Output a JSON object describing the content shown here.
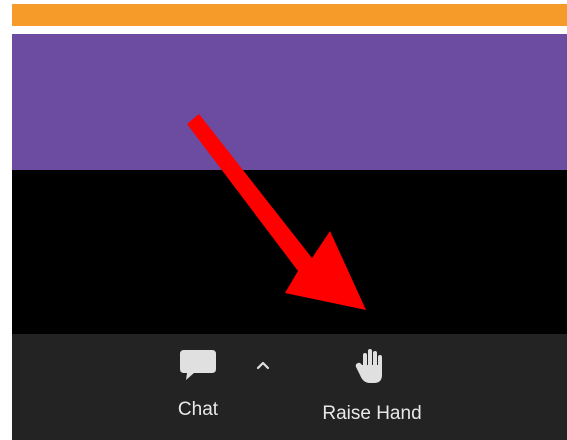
{
  "colors": {
    "orange_bar": "#f69a2a",
    "purple_band": "#6c4ca1",
    "video_area": "#000000",
    "toolbar_bg": "#232323",
    "toolbar_text": "#e8e8e8",
    "annotation_arrow": "#ff0000"
  },
  "toolbar": {
    "chat": {
      "label": "Chat",
      "icon": "chat-bubble-icon"
    },
    "chat_options": {
      "icon": "caret-up-icon"
    },
    "raise_hand": {
      "label": "Raise Hand",
      "icon": "raised-hand-icon"
    }
  },
  "annotation": {
    "icon": "red-arrow-icon"
  }
}
